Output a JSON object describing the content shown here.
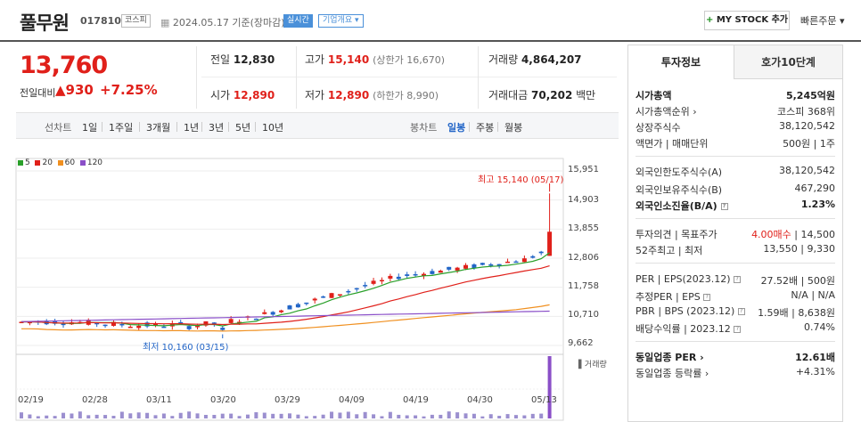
{
  "header": {
    "stock_name": "풀무원",
    "stock_code": "017810",
    "market_badge": "코스피",
    "date_text": "2024.05.17 기준(장마감)",
    "realtime_badge": "실시간",
    "company_info_badge": "기업개요 ▾",
    "mystock_label": "MY STOCK 추가",
    "quick_order_label": "빠른주문 ▾"
  },
  "summary": {
    "price": "13,760",
    "change_label": "전일대비",
    "change": "▲930",
    "change_pct": "+7.25%",
    "prev_close_label": "전일",
    "prev_close": "12,830",
    "high_label": "고가",
    "high": "15,140",
    "upper_limit": "(상한가 16,670)",
    "volume_label": "거래량",
    "volume": "4,864,207",
    "open_label": "시가",
    "open": "12,890",
    "low_label": "저가",
    "low": "12,890",
    "lower_limit": "(하한가 8,990)",
    "amount_label": "거래대금",
    "amount": "70,202",
    "amount_unit": "백만"
  },
  "period_bar": {
    "line_label": "선차트",
    "periods": [
      "1일",
      "1주일",
      "3개월",
      "1년",
      "3년",
      "5년",
      "10년"
    ],
    "candle_label": "봉차트",
    "candle_periods": [
      "일봉",
      "주봉",
      "월봉"
    ],
    "active": "일봉"
  },
  "chart_data": {
    "type": "candlestick",
    "legend": [
      {
        "name": "5",
        "color": "#2aa02a"
      },
      {
        "name": "20",
        "color": "#e0201a"
      },
      {
        "name": "60",
        "color": "#f09020"
      },
      {
        "name": "120",
        "color": "#8a4fc8"
      }
    ],
    "y_ticks": [
      "15,951",
      "14,903",
      "13,855",
      "12,806",
      "11,758",
      "10,710",
      "9,662"
    ],
    "ylim": [
      9662,
      15951
    ],
    "x_ticks": [
      "02/19",
      "02/28",
      "03/11",
      "03/20",
      "03/29",
      "04/09",
      "04/19",
      "04/30",
      "05/13"
    ],
    "annotations": {
      "high": "최고 15,140 (05/17)",
      "low": "최저 10,160 (03/15)"
    },
    "volume_label": "거래량",
    "up_color": "#e0201a",
    "down_color": "#2265c7"
  },
  "panel": {
    "tabs": [
      "투자정보",
      "호가10단계"
    ],
    "rows": [
      {
        "k": "시가총액",
        "v": "5,245억원",
        "bold": true
      },
      {
        "k": "시가총액순위 ›",
        "v": "코스피 368위"
      },
      {
        "k": "상장주식수",
        "v": "38,120,542"
      },
      {
        "k": "액면가 | 매매단위",
        "v": "500원 | 1주"
      },
      {
        "k": "외국인한도주식수(A)",
        "v": "38,120,542"
      },
      {
        "k": "외국인보유주식수(B)",
        "v": "467,290"
      },
      {
        "k": "외국인소진율(B/A)",
        "v": "1.23%",
        "bold": true
      },
      {
        "k": "투자의견 | 목표주가",
        "v1": "4.00매수",
        "v2": " | 14,500"
      },
      {
        "k": "52주최고 | 최저",
        "v": "13,550 | 9,330"
      },
      {
        "k": "PER | EPS(2023.12)",
        "v": "27.52배 | 500원"
      },
      {
        "k": "추정PER | EPS",
        "v": "N/A | N/A"
      },
      {
        "k": "PBR | BPS (2023.12)",
        "v": "1.59배 | 8,638원"
      },
      {
        "k": "배당수익률 | 2023.12",
        "v": "0.74%"
      },
      {
        "k": "동일업종 PER ›",
        "v": "12.61배",
        "bold": true
      },
      {
        "k": "동일업종 등락률 ›",
        "v": "+4.31%",
        "red": true
      }
    ]
  }
}
